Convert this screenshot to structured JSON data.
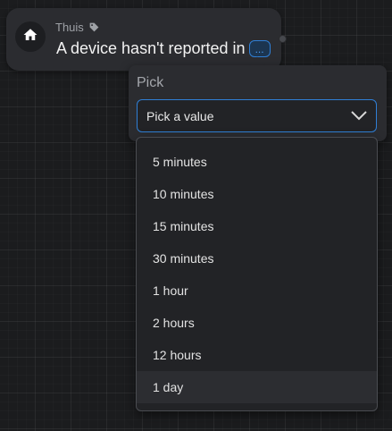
{
  "card": {
    "group": "Thuis",
    "sentence": "A device hasn't reported in",
    "argument_placeholder": "...",
    "icons": {
      "zone": "home-icon",
      "tag": "tag-icon"
    }
  },
  "picker": {
    "label": "Pick",
    "selected_text": "Pick a value",
    "options": [
      {
        "label": "5 minutes"
      },
      {
        "label": "10 minutes"
      },
      {
        "label": "15 minutes"
      },
      {
        "label": "30 minutes"
      },
      {
        "label": "1 hour"
      },
      {
        "label": "2 hours"
      },
      {
        "label": "12 hours"
      },
      {
        "label": "1 day"
      }
    ],
    "hovered_option": "1 day"
  },
  "colors": {
    "accent": "#2f7fd6",
    "canvas": "#1b1c1e",
    "card": "#2b2c30",
    "dropdown": "#222326"
  }
}
